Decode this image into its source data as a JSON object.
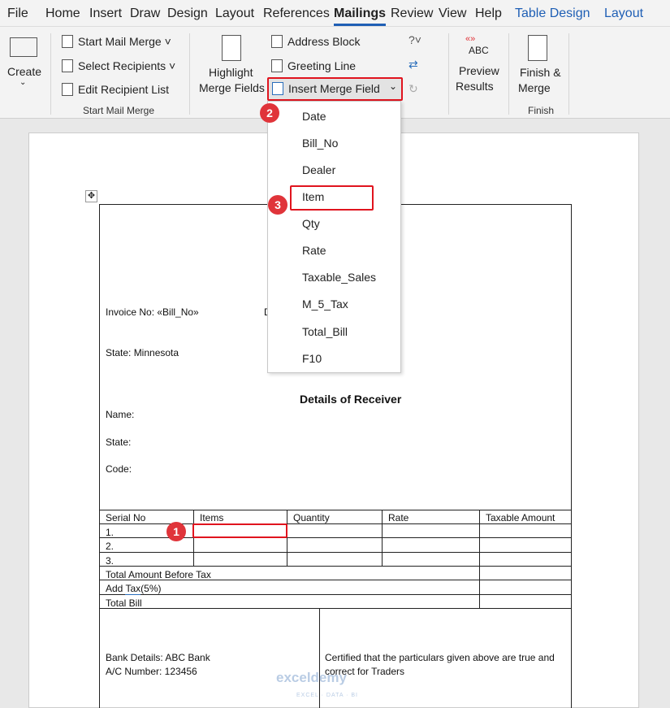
{
  "tabs": [
    "File",
    "Home",
    "Insert",
    "Draw",
    "Design",
    "Layout",
    "References",
    "Mailings",
    "Review",
    "View",
    "Help",
    "Table Design",
    "Layout"
  ],
  "ribbon": {
    "create": "Create",
    "start_mail_merge": "Start Mail Merge",
    "select_recipients": "Select Recipients",
    "edit_recipient_list": "Edit Recipient List",
    "group_start": "Start Mail Merge",
    "highlight1": "Highlight",
    "highlight2": "Merge Fields",
    "address_block": "Address Block",
    "greeting_line": "Greeting Line",
    "insert_merge_field": "Insert Merge Field",
    "preview_icon": "ABC",
    "preview1": "Preview",
    "preview2": "Results",
    "finish1": "Finish &",
    "finish2": "Merge",
    "group_finish": "Finish"
  },
  "menu": [
    "Date",
    "Bill_No",
    "Dealer",
    "Item",
    "Qty",
    "Rate",
    "Taxable_Sales",
    "M_5_Tax",
    "Total_Bill",
    "F10"
  ],
  "badges": [
    "1",
    "2",
    "3"
  ],
  "doc": {
    "invoice": "Invoice No: «Bill_No»",
    "date_partial": "D",
    "state": "State: Minnesota",
    "receiver_title": "Details of Receiver",
    "name": "Name:",
    "state2": "State:",
    "code": "Code:",
    "headers": [
      "Serial No",
      "Items",
      "Quantity",
      "Rate",
      "Taxable Amount"
    ],
    "rows": [
      "1.",
      "2.",
      "3."
    ],
    "total_before": "Total Amount Before Tax",
    "add_tax_a": "Add ",
    "add_tax_b": "Tax",
    "add_tax_c": "(5%)",
    "total_bill": "Total Bill",
    "bank": "Bank Details: ABC Bank",
    "acnum": "A/C Number: 123456",
    "cert1": "Certified that the particulars given above are true and",
    "cert2": "correct for Traders"
  },
  "watermark": {
    "name": "exceldemy",
    "tag": "EXCEL · DATA · BI"
  }
}
